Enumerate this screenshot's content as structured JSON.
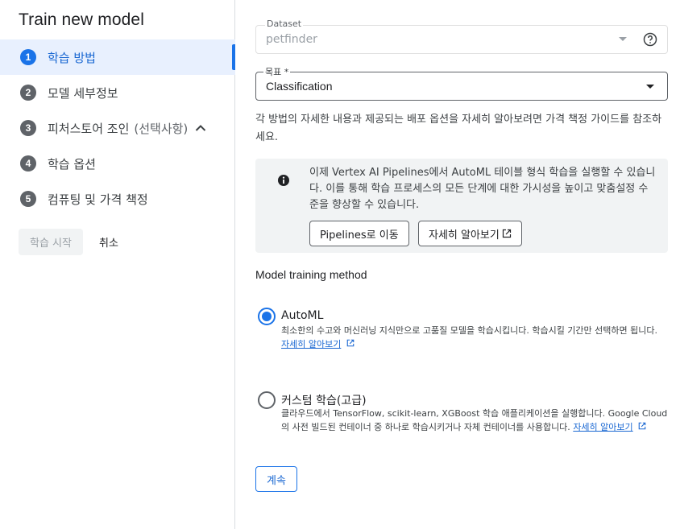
{
  "wizard": {
    "title": "Train new model",
    "steps": [
      {
        "number": "1",
        "label": "학습 방법",
        "active": true
      },
      {
        "number": "2",
        "label": "모델 세부정보"
      },
      {
        "number": "3",
        "label": "피처스토어 조인",
        "optional": "(선택사항)",
        "icon": "chevron-up-icon"
      },
      {
        "number": "4",
        "label": "학습 옵션"
      },
      {
        "number": "5",
        "label": "컴퓨팅 및 가격 책정"
      }
    ],
    "start_label": "학습 시작",
    "cancel_label": "취소"
  },
  "form": {
    "dataset": {
      "label": "Dataset",
      "value": "petfinder",
      "help_icon": "help-icon"
    },
    "goal": {
      "label": "목표 *",
      "value": "Classification"
    },
    "description": "각 방법의 자세한 내용과 제공되는 배포 옵션을 자세히 알아보려면 가격 책정 가이드를 참조하세요.",
    "info": {
      "icon": "info-icon",
      "text": "이제 Vertex AI Pipelines에서 AutoML 테이블 형식 학습을 실행할 수 있습니다. 이를 통해 학습 프로세스의 모든 단계에 대한 가시성을 높이고 맞춤설정 수준을 향상할 수 있습니다.",
      "pipelines_button": "Pipelines로 이동",
      "learn_more_button": "자세히 알아보기"
    },
    "method_title": "Model training method",
    "methods": [
      {
        "title": "AutoML",
        "selected": true,
        "description": "최소한의 수고와 머신러닝 지식만으로 고품질 모델을 학습시킵니다. 학습시킬 기간만 선택하면 됩니다.",
        "link": "자세히 알아보기"
      },
      {
        "title": "커스텀 학습(고급)",
        "selected": false,
        "description": "클라우드에서 TensorFlow, scikit-learn, XGBoost 학습 애플리케이션을 실행합니다. Google Cloud의 사전 빌드된 컨테이너 중 하나로 학습시키거나 자체 컨테이너를 사용합니다.",
        "link": "자세히 알아보기"
      }
    ],
    "continue_label": "계속"
  },
  "colors": {
    "accent": "#1a73e8",
    "active_bg": "#e8f0fe",
    "info_bg": "#f1f3f4"
  }
}
